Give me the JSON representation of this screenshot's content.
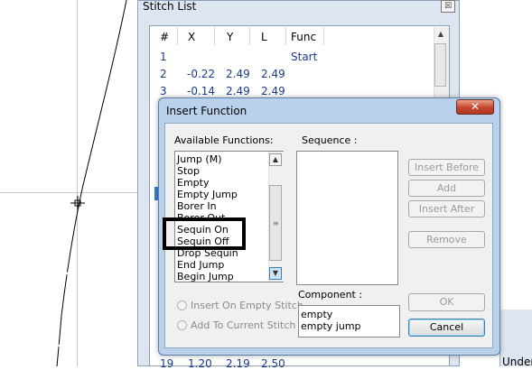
{
  "stitch_list": {
    "title": "Stitch List",
    "close_glyph": "☒",
    "columns": [
      "#",
      "X",
      "Y",
      "L",
      "Func"
    ],
    "rows": [
      {
        "n": "1",
        "x": "",
        "y": "",
        "l": "",
        "func": "Start"
      },
      {
        "n": "2",
        "x": "-0.22",
        "y": "2.49",
        "l": "2.49",
        "func": ""
      },
      {
        "n": "3",
        "x": "-0.14",
        "y": "2.49",
        "l": "2.49",
        "func": ""
      }
    ],
    "bottom_row": {
      "n": "19",
      "x": "1.20",
      "y": "2.19",
      "l": "2.50"
    }
  },
  "under_label": "Under",
  "dialog": {
    "title": "Insert Function",
    "close_glyph": "✕",
    "available_label": "Available Functions:",
    "functions": [
      "Jump (M)",
      "Stop",
      "Empty",
      "Empty Jump",
      "Borer In",
      "Borer Out",
      "Sequin On",
      "Sequin Off",
      "Drop Sequin",
      "End Jump",
      "Begin Jump"
    ],
    "sequence_label": "Sequence :",
    "buttons": {
      "insert_before": "Insert Before",
      "add": "Add",
      "insert_after": "Insert After",
      "remove": "Remove",
      "ok": "OK",
      "cancel": "Cancel"
    },
    "options": {
      "insert_on_empty": "Insert On Empty Stitch",
      "add_to_current": "Add To Current Stitch"
    },
    "component_label": "Component :",
    "components": [
      "empty",
      "empty jump"
    ]
  }
}
